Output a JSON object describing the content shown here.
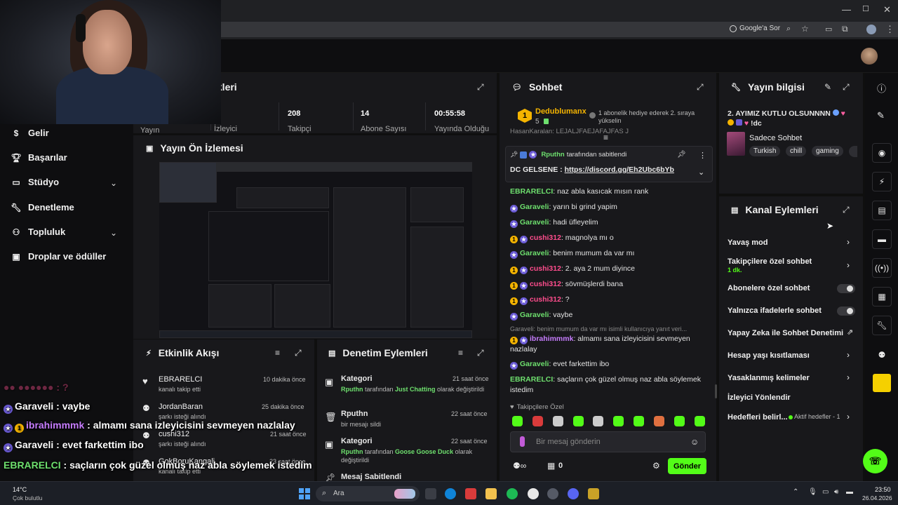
{
  "browser": {
    "title_actions": [
      "—",
      "☐",
      "✕"
    ],
    "search_chip": "Google'a Sor"
  },
  "sidebar": {
    "items": [
      {
        "label": "Gelir",
        "icon": "money-icon"
      },
      {
        "label": "Başarılar",
        "icon": "trophy-icon"
      },
      {
        "label": "Stüdyo",
        "icon": "studio-icon"
      },
      {
        "label": "Denetleme",
        "icon": "wrench-icon"
      },
      {
        "label": "Topluluk",
        "icon": "community-icon"
      },
      {
        "label": "Droplar ve ödüller",
        "icon": "gift-icon"
      }
    ]
  },
  "stats": {
    "title": "ikleri",
    "items": [
      {
        "value": "",
        "label": "Yayın"
      },
      {
        "value": "",
        "label": "İzleyici"
      },
      {
        "value": "208",
        "label": "Takipçi"
      },
      {
        "value": "14",
        "label": "Abone Sayısı"
      },
      {
        "value": "00:55:58",
        "label": "Yayında Olduğu"
      }
    ]
  },
  "preview": {
    "title": "Yayın Ön İzlemesi"
  },
  "activity": {
    "title": "Etkinlik Akışı",
    "items": [
      {
        "user": "EBRARELCI",
        "desc": "kanalı takip etti",
        "time": "10 dakika önce",
        "icon": "heart-icon"
      },
      {
        "user": "JordanBaran",
        "desc": "şarkı isteği alındı",
        "time": "25 dakika önce",
        "icon": "coins-icon"
      },
      {
        "user": "cushi312",
        "desc": "şarkı isteği alındı",
        "time": "21 saat önce",
        "icon": "coins-icon"
      },
      {
        "user": "GokBoruKangali",
        "desc": "kanalı takip etti",
        "time": "23 saat önce",
        "icon": "coins-icon"
      }
    ]
  },
  "moderation": {
    "title": "Denetim Eylemleri",
    "items": [
      {
        "title": "Kategori",
        "time": "21 saat önce",
        "actor": "Rputhn",
        "mid": " tarafından ",
        "target": "Just Chatting",
        "suffix": " olarak değiştirildi",
        "icon": "category-icon"
      },
      {
        "title": "Rputhn",
        "time": "22 saat önce",
        "desc": "bir mesajı sildi",
        "icon": "trash-icon"
      },
      {
        "title": "Kategori",
        "time": "22 saat önce",
        "actor": "Rputhn",
        "mid": " tarafından ",
        "target": "Goose Goose Duck",
        "suffix": " olarak değiştirildi",
        "icon": "category-icon"
      },
      {
        "title": "Mesaj Sabitlendi",
        "time": "",
        "icon": "pin-icon"
      }
    ]
  },
  "chat": {
    "title": "Sohbet",
    "top_gifter": {
      "name": "Dedublumanx",
      "count": "5",
      "rank": "1",
      "note": "1 abonelik hediye ederek 2. sıraya yükselin"
    },
    "hidden_line": "HasanKaralan: LEJALJFAEJAFAJFAS J",
    "pinned": {
      "by": "Rputhn",
      "by_suffix": " tarafından sabitlendi",
      "text_prefix": "DC GELSENE : ",
      "link": "https://discord.gg/Eh2Ubc6bYb"
    },
    "messages": [
      {
        "user": "EBRARELCI",
        "text": ": naz abla kasıcak mısın rank",
        "color": "#6ee06e",
        "badges": []
      },
      {
        "user": "Garaveli",
        "text": ": yarın bi grind yapim",
        "color": "#6ee06e",
        "badges": [
          "star"
        ]
      },
      {
        "user": "Garaveli",
        "text": ": hadi üfleyelim",
        "color": "#6ee06e",
        "badges": [
          "star"
        ]
      },
      {
        "user": "cushi312",
        "text": ": magnolya mı o",
        "color": "#ff4d8d",
        "badges": [
          "gold",
          "star"
        ]
      },
      {
        "user": "Garaveli",
        "text": ": benim mumum da var mı",
        "color": "#6ee06e",
        "badges": [
          "star"
        ]
      },
      {
        "user": "cushi312",
        "text": ": 2. aya 2 mum diyince",
        "color": "#ff4d8d",
        "badges": [
          "gold",
          "star"
        ]
      },
      {
        "user": "cushi312",
        "text": ": sövmüşlerdi bana",
        "color": "#ff4d8d",
        "badges": [
          "gold",
          "star"
        ]
      },
      {
        "user": "cushi312",
        "text": ": ?",
        "color": "#ff4d8d",
        "badges": [
          "gold",
          "star"
        ]
      },
      {
        "user": "Garaveli",
        "text": ": vaybe",
        "color": "#6ee06e",
        "badges": [
          "star"
        ]
      }
    ],
    "reply_hint": "Garaveli: benim mumum da var mı isimli kullanıcıya yanıt veri...",
    "messages2": [
      {
        "user": "ibrahimmmk",
        "text": ": almamı sana izleyicisini sevmeyen nazlalay",
        "color": "#c77dff",
        "badges": [
          "gold",
          "star"
        ]
      },
      {
        "user": "Garaveli",
        "text": ": evet farkettim ibo",
        "color": "#6ee06e",
        "badges": [
          "star"
        ]
      },
      {
        "user": "EBRARELCI",
        "text": ": saçların çok güzel olmuş naz abla söylemek istedim",
        "color": "#6ee06e",
        "badges": []
      }
    ],
    "followers_only": "Takipçilere Özel",
    "input_placeholder": "Bir mesaj gönderin",
    "points": "0",
    "send_label": "Gönder"
  },
  "stream_info": {
    "title": "Yayın bilgisi",
    "stream_title": "2. AYIMIZ KUTLU OLSUNNNN",
    "stream_title2": "!dc",
    "category": "Sadece Sohbet",
    "tags": [
      "Turkish",
      "chill",
      "gaming"
    ]
  },
  "channel_actions": {
    "title": "Kanal Eylemleri",
    "slow_mode": "Yavaş mod",
    "followers_chat": "Takipçilere özel sohbet",
    "followers_chat_value": "1 dk.",
    "subs_chat": "Abonelere özel sohbet",
    "emote_chat": "Yalnızca ifadelerle sohbet",
    "ai_mod": "Yapay Zeka ile Sohbet Denetimi",
    "age_limit": "Hesap yaşı kısıtlaması",
    "banned_words": "Yasaklanmış kelimeler",
    "raid": "İzleyici Yönlendir",
    "goals": "Hedefleri belirl...",
    "goals_status": "Aktif hedefler - 1"
  },
  "overlay_chat": [
    {
      "user": "Garaveli",
      "text": " : vaybe",
      "color": "#ffffff"
    },
    {
      "user": "ibrahimmmk",
      "text": " : almamı sana izleyicisini sevmeyen nazlalay",
      "color": "#c77dff"
    },
    {
      "user": "Garaveli",
      "text": " : evet farkettim ibo",
      "color": "#ffffff"
    },
    {
      "user": "EBRARELCI",
      "text": " : saçların çok güzel olmuş naz abla söylemek istedim",
      "color": "#6ee06e"
    }
  ],
  "taskbar": {
    "weather_temp": "14°C",
    "weather_desc": "Çok bulutlu",
    "search_label": "Ara",
    "time": "23:50",
    "date": "26.04.2026"
  }
}
